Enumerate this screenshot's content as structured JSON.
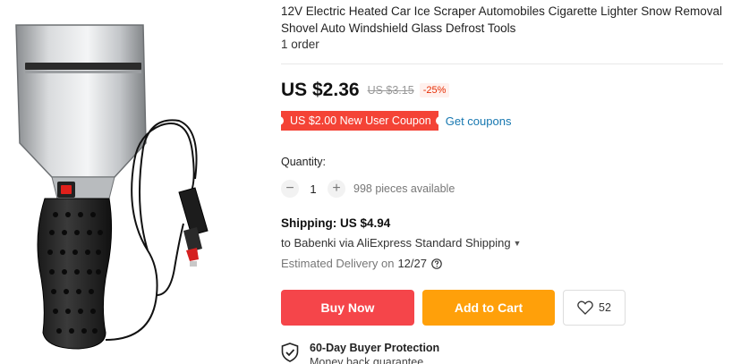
{
  "product": {
    "title": "12V Electric Heated Car Ice Scraper Automobiles Cigarette Lighter Snow Removal Shovel Auto Windshield Glass Defrost Tools",
    "orders": "1 order",
    "image_name": "heated-ice-scraper-product-image"
  },
  "price": {
    "current": "US $2.36",
    "original": "US $3.15",
    "discount": "-25%"
  },
  "coupon": {
    "label": "US $2.00 New User Coupon",
    "link": "Get coupons"
  },
  "quantity": {
    "label": "Quantity:",
    "value": "1",
    "minus": "−",
    "plus": "+",
    "available": "998 pieces available"
  },
  "shipping": {
    "title": "Shipping: US $4.94",
    "to": "to Babenki via AliExpress Standard Shipping",
    "delivery_label": "Estimated Delivery on",
    "delivery_date": "12/27"
  },
  "actions": {
    "buy_now": "Buy Now",
    "add_to_cart": "Add to Cart",
    "wishlist_count": "52"
  },
  "protection": {
    "title": "60-Day Buyer Protection",
    "subtitle": "Money back guarantee"
  },
  "colors": {
    "buy_now": "#f5454a",
    "add_to_cart": "#ffa00a",
    "coupon": "#f44336",
    "link": "#1677b0",
    "discount": "#e62e04"
  }
}
